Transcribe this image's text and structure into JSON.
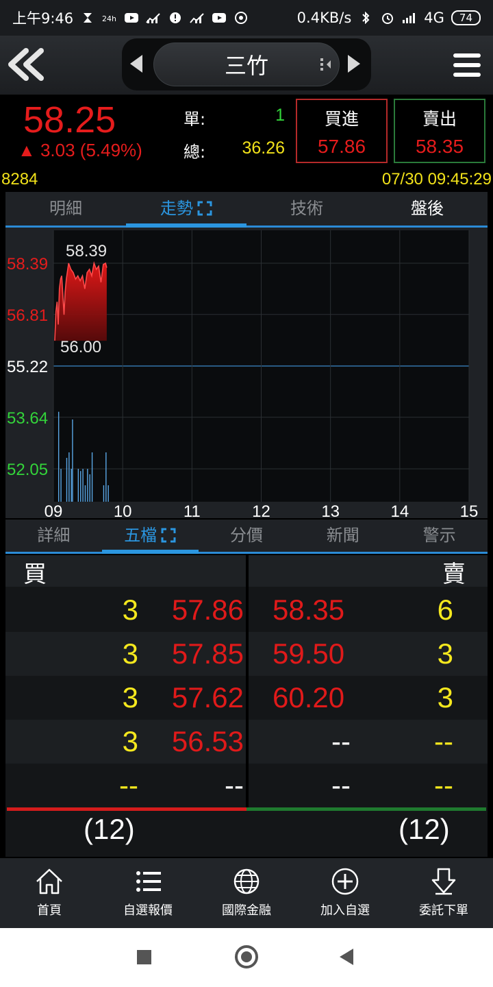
{
  "status_bar": {
    "time": "上午9:46",
    "network_speed": "0.4KB/s",
    "network_type": "4G",
    "battery": "74"
  },
  "header": {
    "stock_name": "三竹"
  },
  "quote": {
    "last_price": "58.25",
    "change": "▲ 3.03 (5.49%)",
    "single_label": "單:",
    "single_value": "1",
    "total_label": "總:",
    "total_value": "36.26",
    "buy_label": "買進",
    "buy_price": "57.86",
    "sell_label": "賣出",
    "sell_price": "58.35",
    "colors": {
      "up": "#e51c1c",
      "volume": "#33d43a",
      "total": "#f2e21a"
    }
  },
  "info": {
    "code": "8284",
    "datetime": "07/30 09:45:29"
  },
  "chart_tabs": [
    {
      "label": "明細"
    },
    {
      "label": "走勢"
    },
    {
      "label": "技術"
    },
    {
      "label": "盤後"
    }
  ],
  "chart_data": {
    "type": "area",
    "y_ticks": [
      "58.39",
      "56.81",
      "55.22",
      "53.64",
      "52.05"
    ],
    "x_ticks": [
      "09",
      "10",
      "11",
      "12",
      "13",
      "14",
      "15"
    ],
    "high_label": "58.39",
    "low_label": "56.00",
    "ylim": [
      52.05,
      58.39
    ],
    "reference_price": 55.22,
    "price_series": {
      "x_minutes": [
        0,
        1,
        2,
        3,
        4,
        5,
        6,
        7,
        8,
        9,
        10,
        12,
        14,
        16,
        18,
        20,
        22,
        24,
        26,
        28,
        30,
        32,
        34,
        36,
        38,
        40,
        42,
        44,
        45
      ],
      "values": [
        56.0,
        56.9,
        57.2,
        56.5,
        57.6,
        57.9,
        58.0,
        57.4,
        56.8,
        57.5,
        57.9,
        58.39,
        58.2,
        58.1,
        57.9,
        58.0,
        57.85,
        58.0,
        57.6,
        58.1,
        58.2,
        58.0,
        58.39,
        58.2,
        58.3,
        57.8,
        58.35,
        58.39,
        58.25
      ]
    },
    "volume_series": {
      "x_minutes": [
        1,
        3,
        8,
        10,
        12,
        13,
        18,
        20,
        22,
        24,
        26,
        28,
        30,
        40,
        42,
        44
      ],
      "values": [
        0.82,
        0.3,
        0.4,
        0.45,
        0.3,
        0.75,
        0.3,
        0.28,
        0.3,
        0.15,
        0.3,
        0.25,
        0.45,
        0.15,
        0.45,
        0.15
      ]
    }
  },
  "detail_tabs": [
    {
      "label": "詳細"
    },
    {
      "label": "五檔"
    },
    {
      "label": "分價"
    },
    {
      "label": "新聞"
    },
    {
      "label": "警示"
    }
  ],
  "order_book": {
    "buy_header": "買",
    "sell_header": "賣",
    "rows": [
      {
        "buy_qty": "3",
        "buy_price": "57.86",
        "sell_price": "58.35",
        "sell_qty": "6"
      },
      {
        "buy_qty": "3",
        "buy_price": "57.85",
        "sell_price": "59.50",
        "sell_qty": "3"
      },
      {
        "buy_qty": "3",
        "buy_price": "57.62",
        "sell_price": "60.20",
        "sell_qty": "3"
      },
      {
        "buy_qty": "3",
        "buy_price": "56.53",
        "sell_price": "--",
        "sell_qty": "--"
      },
      {
        "buy_qty": "--",
        "buy_price": "--",
        "sell_price": "--",
        "sell_qty": "--"
      }
    ],
    "buy_total": "(12)",
    "sell_total": "(12)"
  },
  "bottom_nav": [
    {
      "label": "首頁",
      "icon": "home-icon"
    },
    {
      "label": "自選報價",
      "icon": "list-icon"
    },
    {
      "label": "國際金融",
      "icon": "globe-icon"
    },
    {
      "label": "加入自選",
      "icon": "add-circle-icon"
    },
    {
      "label": "委託下單",
      "icon": "order-down-icon"
    }
  ]
}
